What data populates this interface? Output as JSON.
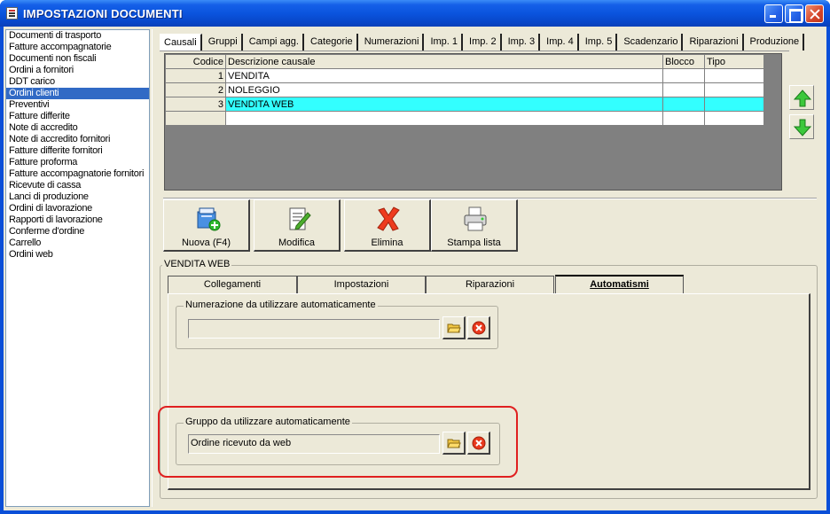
{
  "window": {
    "title": "IMPOSTAZIONI DOCUMENTI"
  },
  "doclist": {
    "selected_index": 5,
    "items": [
      "Documenti di trasporto",
      "Fatture accompagnatorie",
      "Documenti non fiscali",
      "Ordini a fornitori",
      "DDT carico",
      "Ordini clienti",
      "Preventivi",
      "Fatture differite",
      "Note di accredito",
      "Note di accredito fornitori",
      "Fatture differite fornitori",
      "Fatture proforma",
      "Fatture accompagnatorie fornitori",
      "Ricevute di cassa",
      "Lanci di produzione",
      "Ordini di lavorazione",
      "Rapporti di lavorazione",
      "Conferme d'ordine",
      "Carrello",
      "Ordini web"
    ]
  },
  "main_tabs": {
    "active_index": 0,
    "items": [
      "Causali",
      "Gruppi",
      "Campi agg.",
      "Categorie",
      "Numerazioni",
      "Imp. 1",
      "Imp. 2",
      "Imp. 3",
      "Imp. 4",
      "Imp. 5",
      "Scadenzario",
      "Riparazioni",
      "Produzione"
    ]
  },
  "grid": {
    "headers": {
      "codice": "Codice",
      "descrizione": "Descrizione causale",
      "blocco": "Blocco",
      "tipo": "Tipo"
    },
    "selected_row": 2,
    "rows": [
      {
        "codice": "1",
        "descrizione": "VENDITA",
        "blocco": "",
        "tipo": ""
      },
      {
        "codice": "2",
        "descrizione": "NOLEGGIO",
        "blocco": "",
        "tipo": ""
      },
      {
        "codice": "3",
        "descrizione": "VENDITA WEB",
        "blocco": "",
        "tipo": ""
      },
      {
        "codice": "",
        "descrizione": "",
        "blocco": "",
        "tipo": ""
      }
    ]
  },
  "side_buttons": {
    "up_icon": "arrow-up-icon",
    "down_icon": "arrow-down-icon",
    "arrow_color": "#2ea82e"
  },
  "toolbar": {
    "nuova_label": "Nuova (F4)",
    "modifica_label": "Modifica",
    "elimina_label": "Elimina",
    "stampa_label": "Stampa lista"
  },
  "detail": {
    "group_title": "VENDITA WEB",
    "tabs": [
      "Collegamenti",
      "Impostazioni",
      "Riparazioni",
      "Automatismi"
    ],
    "active_tab_index": 3,
    "numerazione": {
      "legend": "Numerazione da utilizzare automaticamente",
      "value": ""
    },
    "gruppo": {
      "legend": "Gruppo da utilizzare automaticamente",
      "value": "Ordine ricevuto da web"
    }
  },
  "colors": {
    "selection_row": "#33ffff",
    "list_selection": "#316ac5",
    "highlight_outline": "#e02020"
  }
}
